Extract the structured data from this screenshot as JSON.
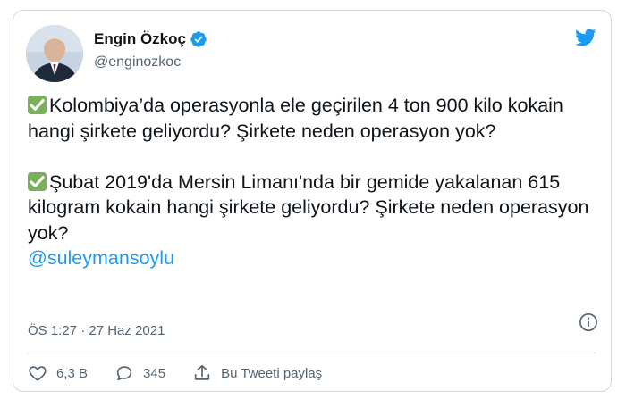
{
  "tweet": {
    "author_name": "Engin Özkoç",
    "author_handle": "@enginozkoc",
    "paragraph1": "Kolombiya’da operasyonla ele geçirilen 4 ton 900 kilo kokain hangi şirkete geliyordu? Şirkete neden operasyon yok?",
    "paragraph2": "Şubat 2019'da Mersin Limanı'nda bir gemide yakalanan 615 kilogram kokain hangi şirkete geliyordu? Şirkete neden operasyon yok?",
    "mention": "@suleymansoylu",
    "timestamp": "ÖS 1:27 · 27 Haz 2021",
    "likes": "6,3 B",
    "replies": "345",
    "share_label": "Bu Tweeti paylaş"
  },
  "icons": {
    "check": "white-heavy-check-mark-icon",
    "verified": "verified-badge-icon",
    "logo": "twitter-bird-icon",
    "info": "info-icon",
    "like": "heart-icon",
    "reply": "speech-bubble-icon",
    "share": "share-icon"
  },
  "colors": {
    "accent": "#1d9bf0",
    "check_green": "#78b159",
    "muted_text": "#536471",
    "border": "#cfd9de"
  }
}
